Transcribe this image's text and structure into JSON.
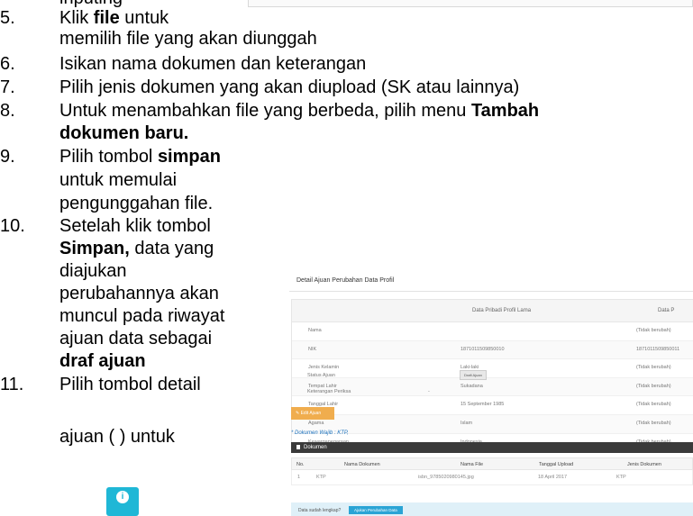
{
  "doc": {
    "cut_top_text": "inputing",
    "items": [
      {
        "num": "5.",
        "lines": [
          {
            "pre": "Klik ",
            "bold": "file",
            "post": " untuk"
          },
          {
            "pre": "memilih file yang akan diunggah",
            "bold": "",
            "post": ""
          }
        ]
      },
      {
        "num": "6.",
        "lines": [
          {
            "pre": "Isikan nama dokumen dan keterangan",
            "bold": "",
            "post": ""
          }
        ]
      },
      {
        "num": "7.",
        "lines": [
          {
            "pre": "Pilih jenis dokumen yang akan diupload (SK atau lainnya)",
            "bold": "",
            "post": ""
          }
        ]
      },
      {
        "num": "8.",
        "lines": [
          {
            "pre": "Untuk menambahkan file yang berbeda, pilih menu ",
            "bold": "Tambah",
            "post": ""
          },
          {
            "pre": "",
            "bold": "dokumen baru.",
            "post": ""
          }
        ]
      },
      {
        "num": "9.",
        "lines": [
          {
            "pre": "Pilih tombol ",
            "bold": "simpan",
            "post": ""
          },
          {
            "pre": "untuk memulai",
            "bold": "",
            "post": ""
          },
          {
            "pre": "pengunggahan file.",
            "bold": "",
            "post": ""
          }
        ]
      },
      {
        "num": "10.",
        "lines": [
          {
            "pre": "Setelah klik tombol",
            "bold": "",
            "post": ""
          },
          {
            "pre": "",
            "bold": "Simpan,",
            "post": " data yang"
          },
          {
            "pre": "diajukan",
            "bold": "",
            "post": ""
          },
          {
            "pre": "perubahannya akan",
            "bold": "",
            "post": ""
          },
          {
            "pre": "muncul pada riwayat",
            "bold": "",
            "post": ""
          },
          {
            "pre": "ajuan data sebagai",
            "bold": "",
            "post": ""
          },
          {
            "pre": "",
            "bold": "draf ajuan",
            "post": ""
          }
        ]
      },
      {
        "num": "11.",
        "lines": [
          {
            "pre": "Pilih tombol detail",
            "bold": "",
            "post": ""
          },
          {
            "pre": "",
            "bold": "",
            "post": ""
          },
          {
            "pre": "ajuan (",
            "bold": "",
            "post": "       ) untuk"
          }
        ]
      }
    ]
  },
  "screenshot": {
    "title": "Detail Ajuan Perubahan Data Profil",
    "col_old": "Data Pribadi Profil Lama",
    "col_new": "Data P",
    "rows": [
      {
        "label": "Nama",
        "old": "",
        "new": "(Tidak berubah)"
      },
      {
        "label": "NIK",
        "old": "1871011509850010",
        "new": "1871011509850011"
      },
      {
        "label": "Jenis Kelamin",
        "old": "Laki-laki",
        "new": "(Tidak berubah)"
      },
      {
        "label": "Tempat Lahir",
        "old": "Sukadana",
        "new": "(Tidak berubah)"
      },
      {
        "label": "Tanggal Lahir",
        "old": "15 September 1985",
        "new": "(Tidak berubah)"
      },
      {
        "label": "Agama",
        "old": "Islam",
        "new": "(Tidak berubah)"
      },
      {
        "label": "Kewarganegaraan",
        "old": "Indonesia",
        "new": "(Tidak berubah)"
      }
    ],
    "status_label": "Status Ajuan",
    "status_badge": "Draft Ajuan",
    "keterangan_label": "Keterangan Periksa",
    "keterangan_value": "-",
    "edit_button": "Edit Ajuan",
    "wajib_text": "* Dokumen Wajib : KTP,",
    "dokumen_title": "Dokumen",
    "doc_headers": [
      "No.",
      "Nama Dokumen",
      "Nama File",
      "Tanggal Upload",
      "Jenis Dokumen"
    ],
    "doc_row": [
      "1",
      "KTP",
      "isbn_9785020980145.jpg",
      "18 April 2017",
      "KTP"
    ],
    "info_text": "Data sudah lengkap?",
    "info_button": "Ajukan Perubahan Data"
  },
  "info_icon_glyph": "i"
}
